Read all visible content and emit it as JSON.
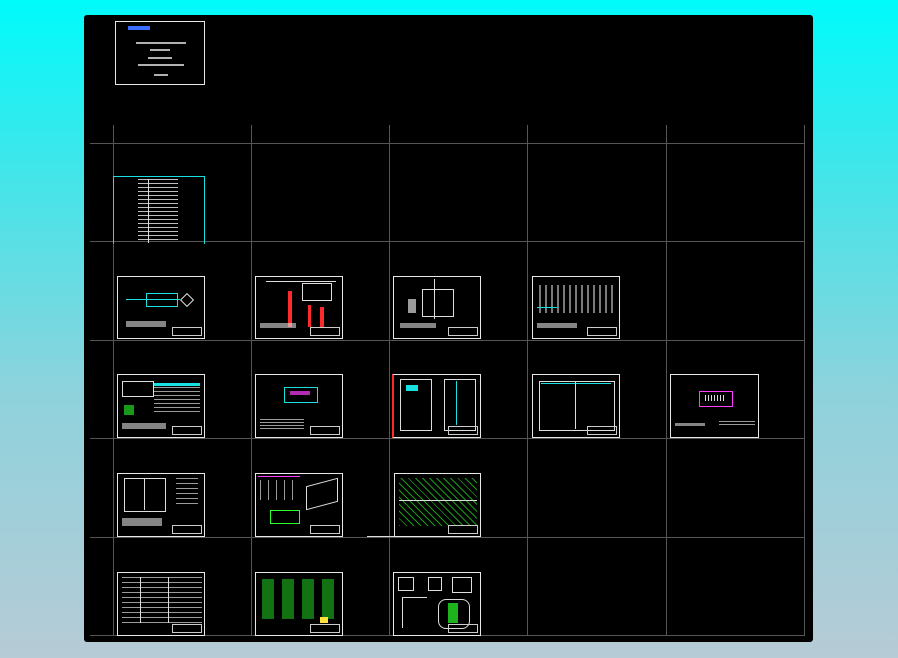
{
  "window": {
    "background_gradient": [
      "#00fbfb",
      "#b6cbd6"
    ],
    "canvas_color": "#000000"
  },
  "cover_sheet": {
    "lines": [
      "",
      "",
      "",
      "",
      ""
    ]
  },
  "drawing_sheets": [
    {
      "id": "index-table"
    },
    {
      "id": "r2c1-system-diagram"
    },
    {
      "id": "r2c2-panel-layout"
    },
    {
      "id": "r2c3-control-wiring"
    },
    {
      "id": "r2c4-electrical-schematic"
    },
    {
      "id": "r3c1-device-table"
    },
    {
      "id": "r3c2-plan-view"
    },
    {
      "id": "r3c3-cabinet-front"
    },
    {
      "id": "r3c4-cabinet-elevation"
    },
    {
      "id": "r3c5-plan-view-2"
    },
    {
      "id": "r4c1-cabinet-outline"
    },
    {
      "id": "r4c2-isometric-assembly"
    },
    {
      "id": "r4c3-green-detail"
    },
    {
      "id": "r5c1-material-table"
    },
    {
      "id": "r5c2-component-grid"
    },
    {
      "id": "r5c3-detail-sections"
    }
  ],
  "colors": {
    "grid": "#555555",
    "sheet_border": "#e8e8e8",
    "cyan": "#19e0e0",
    "red": "#ff2a2a",
    "green": "#2aff2a",
    "blue": "#3a6dff"
  }
}
